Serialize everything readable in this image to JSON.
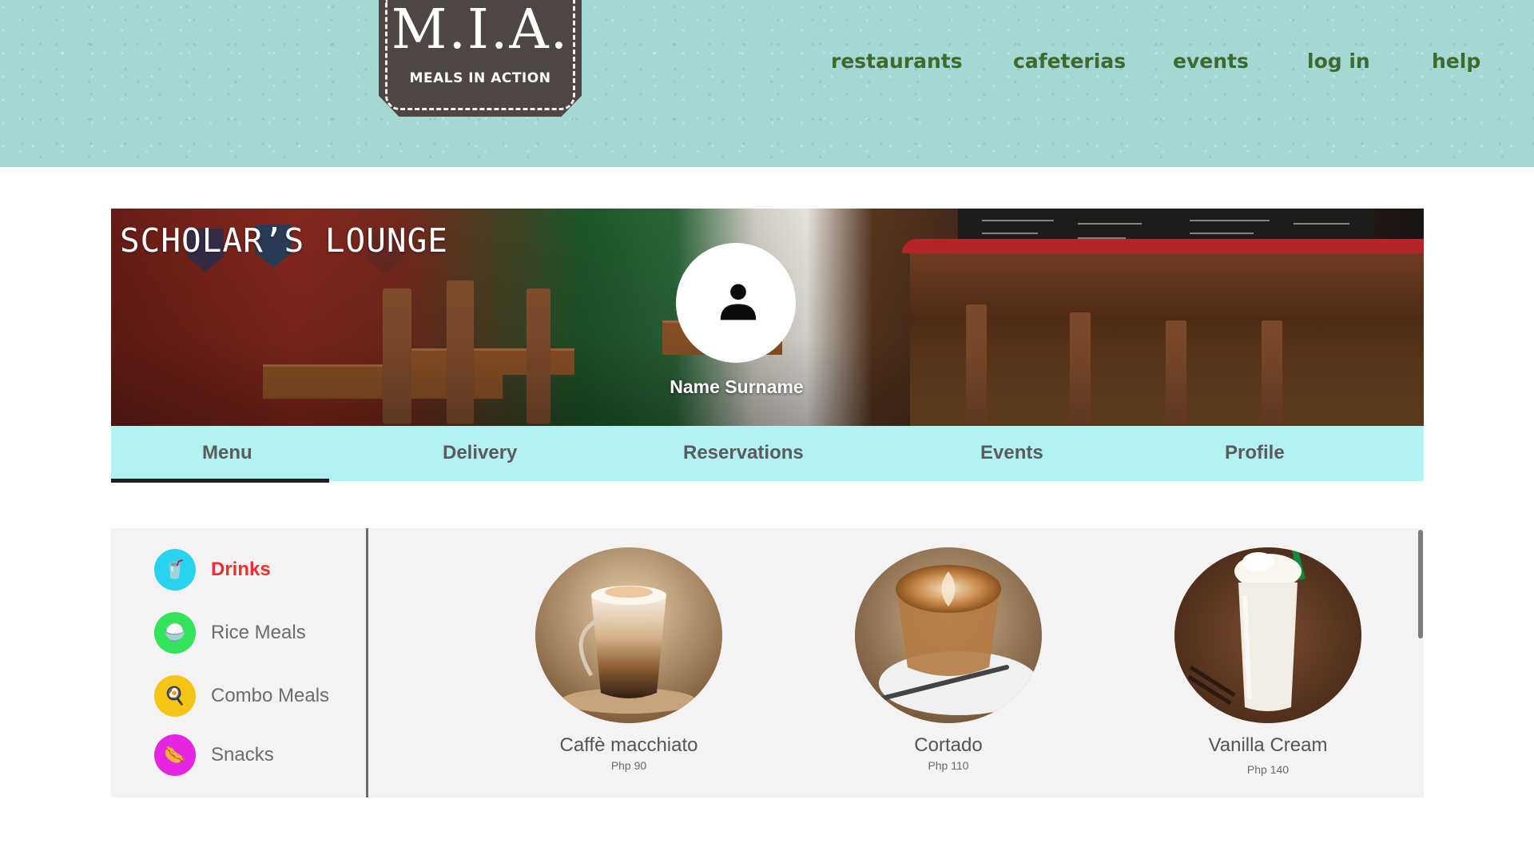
{
  "header": {
    "logo_title": "M.I.A.",
    "logo_subtitle": "MEALS IN ACTION",
    "nav": [
      "restaurants",
      "cafeterias",
      "events",
      "log in",
      "help"
    ]
  },
  "banner": {
    "title": "SCHOLAR’S LOUNGE",
    "user_name": "Name Surname",
    "avatar_icon": "person-icon"
  },
  "tabs": [
    "Menu",
    "Delivery",
    "Reservations",
    "Events",
    "Profile"
  ],
  "active_tab": "Menu",
  "categories": [
    {
      "label": "Drinks",
      "icon": "drink-icon",
      "color": "#29d3ee",
      "glyph": "🥤"
    },
    {
      "label": "Rice Meals",
      "icon": "rice-bowl-icon",
      "color": "#33e35a",
      "glyph": "🍚"
    },
    {
      "label": "Combo Meals",
      "icon": "combo-meal-icon",
      "color": "#f5c515",
      "glyph": "🍳"
    },
    {
      "label": "Snacks",
      "icon": "hotdog-icon",
      "color": "#e526e0",
      "glyph": "🌭"
    }
  ],
  "active_category": "Drinks",
  "products": [
    {
      "name": "Caffè macchiato",
      "price": "Php 90"
    },
    {
      "name": "Cortado",
      "price": "Php 110"
    },
    {
      "name": "Vanilla Cream",
      "price": "Php 140"
    }
  ],
  "colors": {
    "header_bg": "#a3d8d4",
    "nav_text": "#3e6a2e",
    "tab_bar": "#b3f1f2",
    "active_category": "#e8322f",
    "menu_bg": "#f4f2f3"
  }
}
